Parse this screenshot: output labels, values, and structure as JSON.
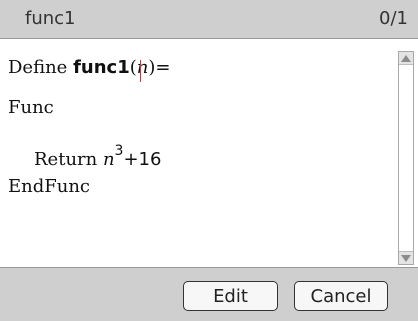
{
  "window": {
    "title": "func1",
    "page_indicator": "0/1"
  },
  "editor": {
    "line1": {
      "keyword": "Define ",
      "function_name": "func1",
      "open_paren": "(",
      "param": "n",
      "close_paren": ")",
      "equals": "="
    },
    "line2": "Func",
    "line3": {
      "keyword": "Return ",
      "base": "n",
      "exponent": "3",
      "rest": "+16"
    },
    "line4": "EndFunc"
  },
  "buttons": {
    "edit": "Edit",
    "cancel": "Cancel"
  },
  "icons": {
    "scroll_up": "triangle-up-icon",
    "scroll_down": "triangle-down-icon"
  },
  "colors": {
    "titlebar_bg": "#cfcfcf",
    "cursor": "#cc3333"
  }
}
